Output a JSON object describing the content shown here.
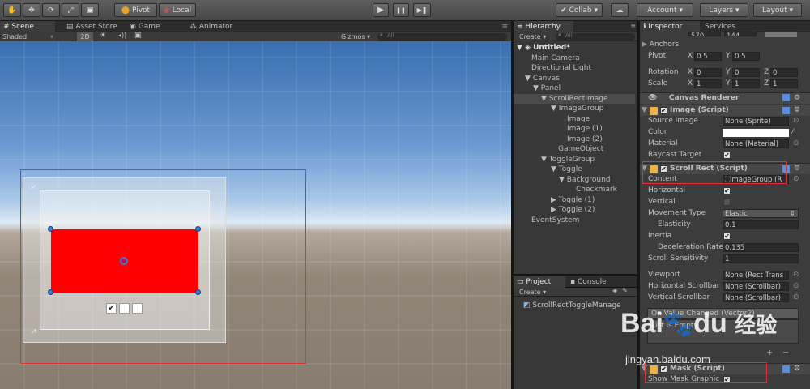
{
  "toolbar": {
    "tools": [
      {
        "icon": "hand-icon",
        "glyph": "✋"
      },
      {
        "icon": "move-icon",
        "glyph": "✥"
      },
      {
        "icon": "rotate-icon",
        "glyph": "⟳"
      },
      {
        "icon": "scale-icon",
        "glyph": "⤢"
      },
      {
        "icon": "rect-tool-icon",
        "glyph": "▣"
      }
    ],
    "pivot": "Pivot",
    "local": "Local",
    "play": "▶",
    "pause": "❚❚",
    "step": "▶❚",
    "collab": "Collab ▾",
    "cloud": "☁",
    "account": "Account ▾",
    "layers": "Layers ▾",
    "layout": "Layout ▾"
  },
  "tabs": {
    "scene": "Scene",
    "asset_store": "Asset Store",
    "game": "Game",
    "animator": "Animator",
    "hierarchy": "Hierarchy",
    "inspector": "Inspector",
    "services": "Services",
    "project": "Project",
    "console": "Console"
  },
  "scene_bar": {
    "shading": "Shaded",
    "mode_2d": "2D",
    "gizmos": "Gizmos ▾",
    "search_placeholder": "All"
  },
  "hierarchy": {
    "create": "Create ▾",
    "search_placeholder": "All",
    "items": [
      {
        "label": "Untitled*",
        "arrow": "▼"
      },
      {
        "label": "Main Camera",
        "arrow": ""
      },
      {
        "label": "Directional Light",
        "arrow": ""
      },
      {
        "label": "Canvas",
        "arrow": "▼"
      },
      {
        "label": "Panel",
        "arrow": "▼"
      },
      {
        "label": "ScrollRectImage",
        "arrow": "▼"
      },
      {
        "label": "ImageGroup",
        "arrow": "▼"
      },
      {
        "label": "Image",
        "arrow": ""
      },
      {
        "label": "Image (1)",
        "arrow": ""
      },
      {
        "label": "Image (2)",
        "arrow": ""
      },
      {
        "label": "GameObject",
        "arrow": ""
      },
      {
        "label": "ToggleGroup",
        "arrow": "▼"
      },
      {
        "label": "Toggle",
        "arrow": "▼"
      },
      {
        "label": "Background",
        "arrow": "▼"
      },
      {
        "label": "Checkmark",
        "arrow": ""
      },
      {
        "label": "Toggle (1)",
        "arrow": "▶"
      },
      {
        "label": "Toggle (2)",
        "arrow": "▶"
      },
      {
        "label": "EventSystem",
        "arrow": ""
      }
    ]
  },
  "project": {
    "create": "Create ▾",
    "file": "ScrollRectToggleManage"
  },
  "inspector": {
    "top_values": [
      "570",
      "144"
    ],
    "anchors": "Anchors",
    "pivot": {
      "label": "Pivot",
      "x_label": "X",
      "x": "0.5",
      "y_label": "Y",
      "y": "0.5"
    },
    "rotation": {
      "label": "Rotation",
      "x_label": "X",
      "x": "0",
      "y_label": "Y",
      "y": "0",
      "z_label": "Z",
      "z": "0"
    },
    "scale": {
      "label": "Scale",
      "x_label": "X",
      "x": "1",
      "y_label": "Y",
      "y": "1",
      "z_label": "Z",
      "z": "1"
    },
    "canvas_renderer": "Canvas Renderer",
    "image_script": {
      "title": "Image (Script)",
      "source_image": {
        "label": "Source Image",
        "value": "None (Sprite)"
      },
      "color": {
        "label": "Color"
      },
      "material": {
        "label": "Material",
        "value": "None (Material)"
      },
      "raycast": {
        "label": "Raycast Target"
      }
    },
    "scroll_rect": {
      "title": "Scroll Rect (Script)",
      "content": {
        "label": "Content",
        "value": "ImageGroup (R"
      },
      "horizontal": "Horizontal",
      "vertical": "Vertical",
      "movement": {
        "label": "Movement Type",
        "value": "Elastic"
      },
      "elasticity": {
        "label": "Elasticity",
        "value": "0.1"
      },
      "inertia": "Inertia",
      "deceleration": {
        "label": "Deceleration Rate",
        "value": "0.135"
      },
      "sensitivity": {
        "label": "Scroll Sensitivity",
        "value": "1"
      },
      "viewport": {
        "label": "Viewport",
        "value": "None (Rect Trans"
      },
      "h_scrollbar": {
        "label": "Horizontal Scrollbar",
        "value": "None (Scrollbar)"
      },
      "v_scrollbar": {
        "label": "Vertical Scrollbar",
        "value": "None (Scrollbar)"
      },
      "on_value": "On Value Changed (Vector2)",
      "list_empty": "List is Empty",
      "plus": "+",
      "minus": "−"
    },
    "mask": {
      "title": "Mask (Script)",
      "show_graphic": "Show Mask Graphic"
    }
  },
  "watermark": {
    "brand": "Bai",
    "brand2": "du",
    "cn": "经验",
    "url": "jingyan.baidu.com"
  },
  "colors": {
    "image_color": "#ff0000",
    "highlight": "#d02a2a"
  }
}
